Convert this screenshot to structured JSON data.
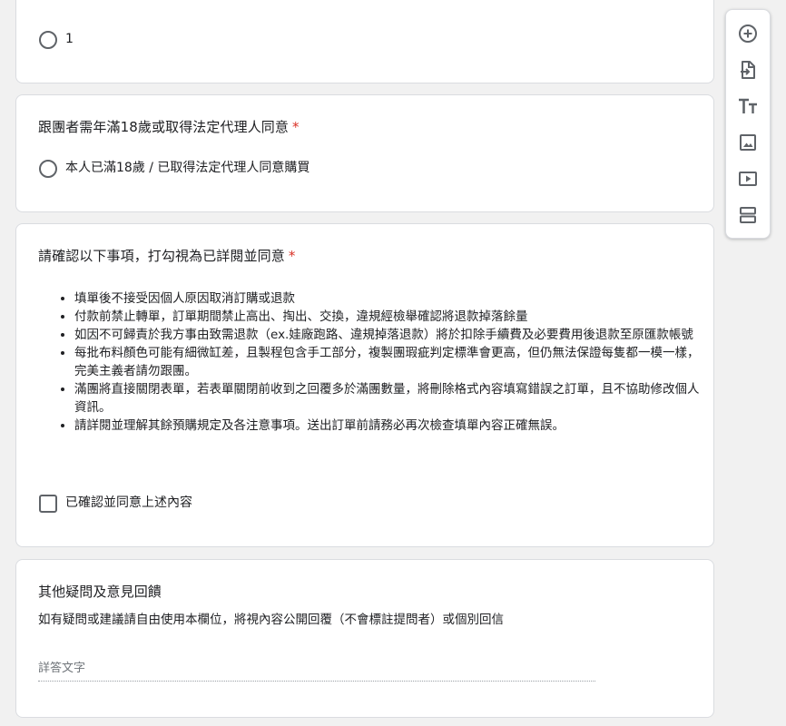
{
  "questions": {
    "option_question": {
      "option_label": "1"
    },
    "age_question": {
      "title": "跟團者需年滿18歲或取得法定代理人同意",
      "required_mark": "*",
      "option_label": "本人已滿18歲 / 已取得法定代理人同意購買"
    },
    "confirm_question": {
      "title": "請確認以下事項，打勾視為已詳閱並同意",
      "required_mark": "*",
      "notes": [
        "填單後不接受因個人原因取消訂購或退款",
        "付款前禁止轉單，訂單期間禁止高出、掏出、交換，違規經檢舉確認將退款掉落餘量",
        "如因不可歸責於我方事由致需退款（ex.娃廠跑路、違規掉落退款）將於扣除手續費及必要費用後退款至原匯款帳號",
        "每批布料顏色可能有細微缸差，且製程包含手工部分，複製團瑕疵判定標準會更高，但仍無法保證每隻都一模一樣，完美主義者請勿跟團。",
        "滿團將直接關閉表單，若表單關閉前收到之回覆多於滿團數量，將刪除格式內容填寫錯誤之訂單，且不協助修改個人資訊。",
        "請詳閱並理解其餘預購規定及各注意事項。送出訂單前請務必再次檢查填單內容正確無誤。"
      ],
      "checkbox_label": "已確認並同意上述內容"
    },
    "feedback_question": {
      "title": "其他疑問及意見回饋",
      "description": "如有疑問或建議請自由使用本欄位，將視內容公開回覆（不會標註提問者）或個別回信",
      "placeholder": "詳答文字",
      "value": ""
    }
  },
  "toolbar": {
    "items": [
      {
        "icon": "add-circle-icon",
        "tooltip": ""
      },
      {
        "icon": "import-icon",
        "tooltip": ""
      },
      {
        "icon": "title-icon",
        "tooltip": ""
      },
      {
        "icon": "image-icon",
        "tooltip": ""
      },
      {
        "icon": "video-icon",
        "tooltip": ""
      },
      {
        "icon": "section-icon",
        "tooltip": ""
      }
    ]
  },
  "colors": {
    "background": "#f1f1f1",
    "card": "#ffffff",
    "required": "#d93025",
    "icon": "#5f6368"
  }
}
